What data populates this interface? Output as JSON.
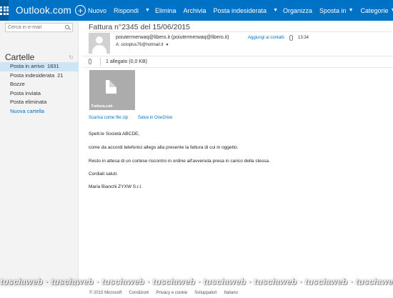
{
  "topbar": {
    "brand": "Outlook.com",
    "new_label": "Nuovo",
    "reply_label": "Rispondi",
    "delete_label": "Elimina",
    "archive_label": "Archivia",
    "junk_label": "Posta indesiderata",
    "organize_label": "Organizza",
    "move_label": "Sposta in",
    "categories_label": "Categorie",
    "more_label": "•••",
    "accent_color": "#0072c6"
  },
  "sidebar": {
    "search_placeholder": "Cerca in e-mail",
    "folders_title": "Cartelle",
    "folders": [
      {
        "label": "Posta in arrivo",
        "count": "1831"
      },
      {
        "label": "Posta indesiderata",
        "count": "21"
      },
      {
        "label": "Bozze",
        "count": ""
      },
      {
        "label": "Posta inviata",
        "count": ""
      },
      {
        "label": "Posta eliminata",
        "count": ""
      },
      {
        "label": "Nuova cartella",
        "count": ""
      }
    ]
  },
  "message": {
    "subject": "Fattura n°2345 del 15/06/2015",
    "sender": "poiutermerwaq@libero.it (poiutermerwaq@libero.it)",
    "add_contact": "Aggiungi ai contatti",
    "time": "13:34",
    "recipient": "A: octoplus76@hotmail.it",
    "attachment_count": "1 allegato (0,0 KB)",
    "attachment_name": "Fattura.cab",
    "download_zip": "Scarica come file zip",
    "save_onedrive": "Salva in OneDrive",
    "body": [
      "Spett.le Società ABCDE,",
      "come da accordi telefonici allego alla presente la fattura di cui in oggetto.",
      "Resto in attesa di un cortese riscontro in ordine all'avvenuta presa in carico della stessa.",
      "Cordiali saluti.",
      "Maria Bianchi ZYXW S.r.l."
    ]
  },
  "watermark": "tusciaweb · tusciaweb · tusciaweb · tusciaweb · tusciaweb · tusciaweb · tusciaweb · tusciaweb",
  "footer": {
    "copyright": "© 2015 Microsoft",
    "terms": "Condizioni",
    "privacy": "Privacy e cookie",
    "developers": "Sviluppatori",
    "language": "Italiano"
  }
}
